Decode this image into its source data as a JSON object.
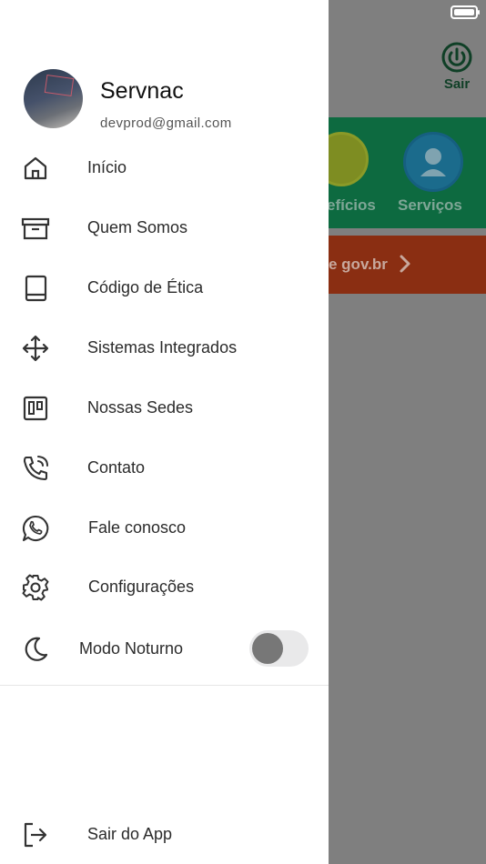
{
  "background": {
    "top_right_button": "Sair",
    "tile_labels": [
      "efícios",
      "Serviços"
    ],
    "banner_text": "e gov.br"
  },
  "drawer": {
    "profile": {
      "name": "Servnac",
      "email": "devprod@gmail.com"
    },
    "items": [
      {
        "label": "Início",
        "icon": "home-icon"
      },
      {
        "label": "Quem Somos",
        "icon": "archive-icon"
      },
      {
        "label": "Código de Ética",
        "icon": "book-icon"
      },
      {
        "label": "Sistemas Integrados",
        "icon": "move-icon"
      },
      {
        "label": "Nossas Sedes",
        "icon": "kanban-icon"
      },
      {
        "label": "Contato",
        "icon": "phone-icon"
      },
      {
        "label": "Fale conosco",
        "icon": "whatsapp-icon"
      },
      {
        "label": "Configurações",
        "icon": "gear-icon"
      }
    ],
    "night_mode": {
      "label": "Modo Noturno",
      "enabled": false
    },
    "logout_label": "Sair do App"
  },
  "colors": {
    "overlay": "#7f7f7f",
    "green_band": "#0d6a40",
    "red_band": "#8a2e12"
  }
}
